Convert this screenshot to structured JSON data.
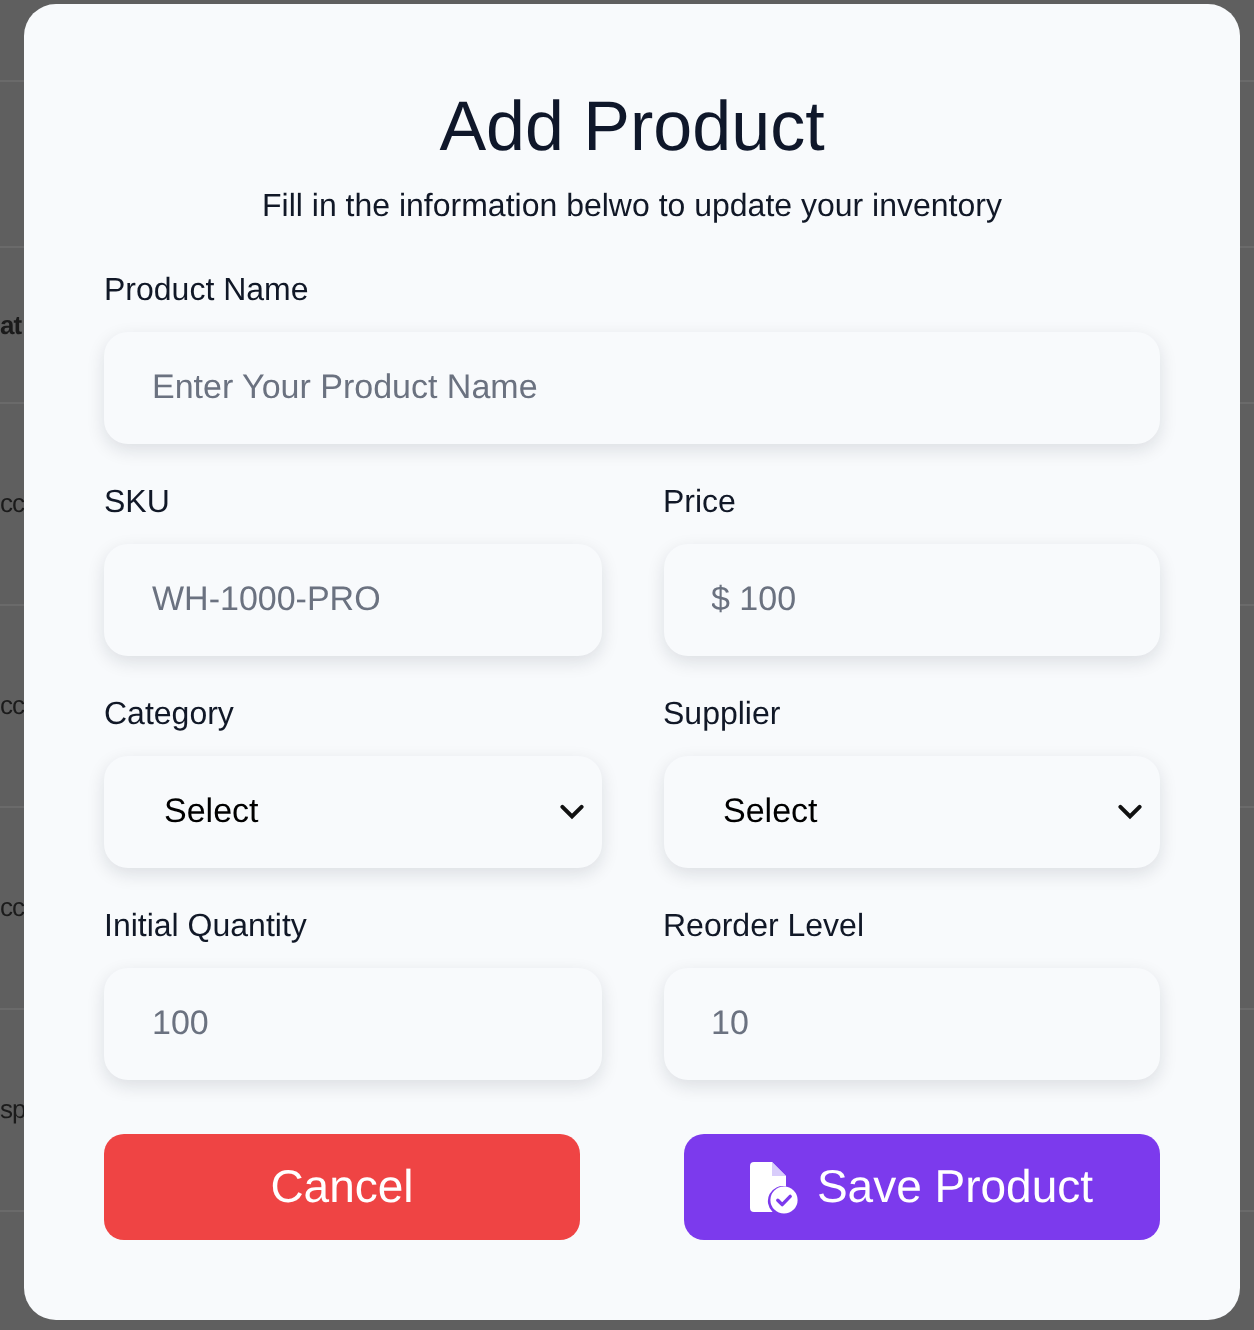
{
  "backdrop_table": {
    "header": "at",
    "rows": [
      "cc",
      "cc",
      "cc",
      "sp"
    ]
  },
  "dialog": {
    "title": "Add Product",
    "subtitle": "Fill in the information belwo to update your inventory",
    "rows": [
      [
        {
          "label": "Product Name",
          "kind": "text",
          "placeholder": "Enter Your Product Name"
        }
      ],
      [
        {
          "label": "SKU",
          "kind": "text",
          "placeholder": "WH-1000-PRO"
        },
        {
          "label": "Price",
          "kind": "text",
          "placeholder": "$ 100"
        }
      ],
      [
        {
          "label": "Category",
          "kind": "select",
          "value": "Select"
        },
        {
          "label": "Supplier",
          "kind": "select",
          "value": "Select"
        }
      ],
      [
        {
          "label": "Initial Quantity",
          "kind": "text",
          "placeholder": "100"
        },
        {
          "label": "Reorder Level",
          "kind": "text",
          "placeholder": "10"
        }
      ]
    ],
    "buttons": [
      {
        "label": "Cancel",
        "kind": "cancel"
      },
      {
        "label": "Save Product",
        "kind": "save"
      }
    ]
  }
}
